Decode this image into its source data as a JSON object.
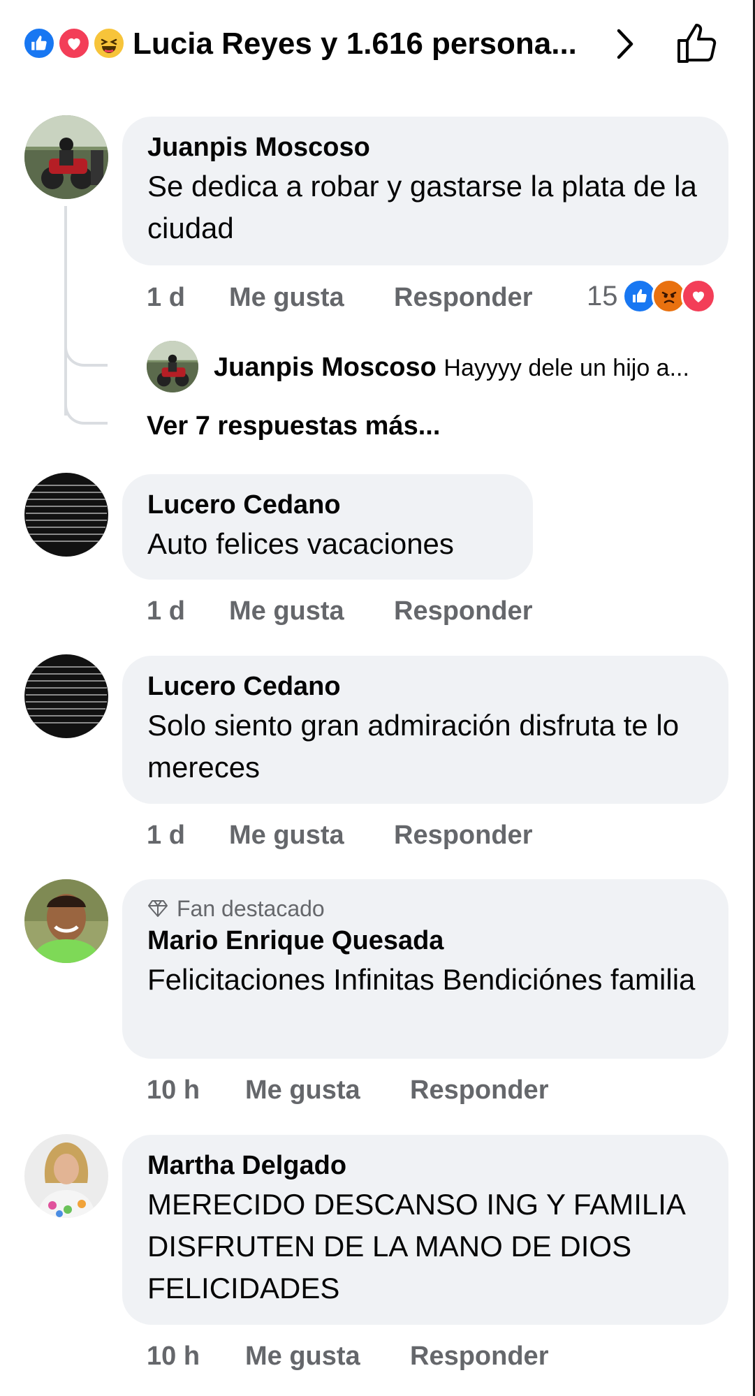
{
  "header": {
    "reactions": [
      "like-icon",
      "love-icon",
      "haha-icon"
    ],
    "title": "Lucia Reyes y 1.616 persona..."
  },
  "comments": [
    {
      "author": "Juanpis Moscoso",
      "text": "Se dedica a robar y gastarse la plata de la ciudad",
      "time": "1 d",
      "like_label": "Me gusta",
      "reply_label": "Responder",
      "reaction_count": "15",
      "reaction_icons": [
        "like-icon",
        "angry-icon",
        "love-icon"
      ],
      "reply_preview": {
        "author": "Juanpis Moscoso",
        "text": "Hayyyy dele un hijo a..."
      },
      "more_replies": "Ver 7 respuestas más..."
    },
    {
      "author": "Lucero Cedano",
      "text": "Auto felices vacaciones",
      "time": "1 d",
      "like_label": "Me gusta",
      "reply_label": "Responder"
    },
    {
      "author": "Lucero Cedano",
      "text": "Solo siento gran admiración disfruta te lo mereces",
      "time": "1 d",
      "like_label": "Me gusta",
      "reply_label": "Responder"
    },
    {
      "badge": "Fan destacado",
      "author": "Mario Enrique Quesada",
      "text": "Felicitaciones Infinitas Bendiciónes familia",
      "time": "10 h",
      "like_label": "Me gusta",
      "reply_label": "Responder"
    },
    {
      "author": "Martha Delgado",
      "text": "MERECIDO DESCANSO ING Y FAMILIA DISFRUTEN DE LA MANO DE DIOS FELICIDADES",
      "time": "10 h",
      "like_label": "Me gusta",
      "reply_label": "Responder"
    }
  ],
  "colors": {
    "bubble": "#f0f2f5",
    "meta": "#65676b",
    "like": "#1877f2",
    "love": "#f33e58",
    "haha": "#f7c43a",
    "angry": "#e9710f"
  }
}
